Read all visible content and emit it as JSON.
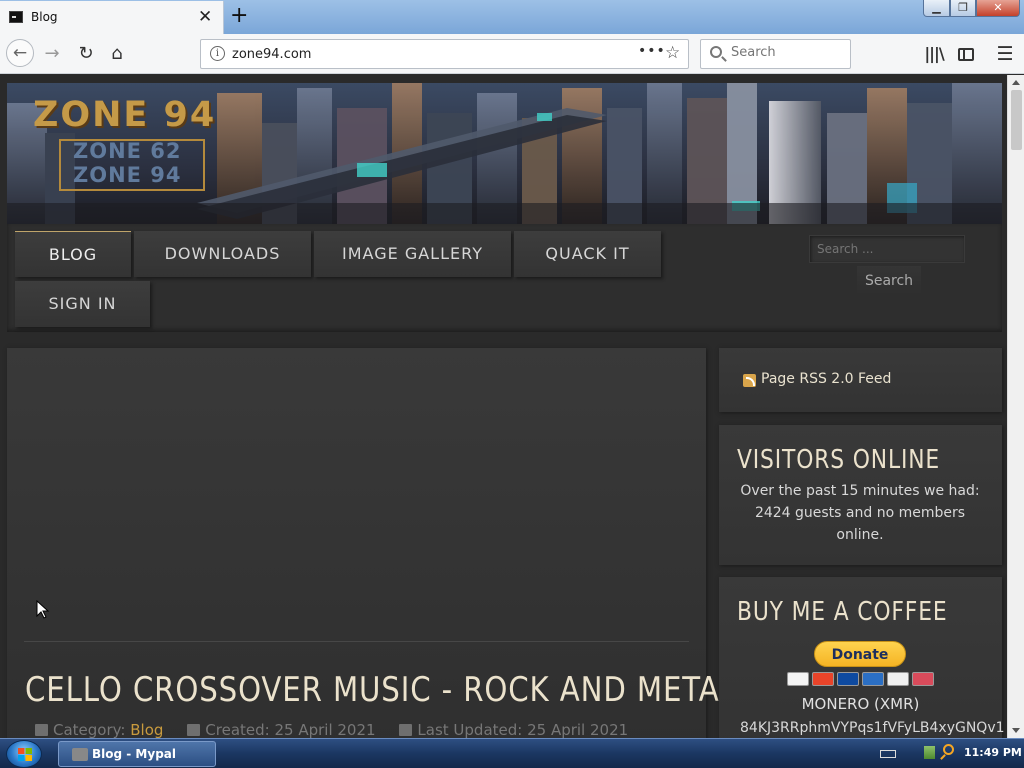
{
  "browser": {
    "tab_title": "Blog",
    "url": "zone94.com",
    "search_placeholder": "Search",
    "window_controls": {
      "minimize": "▁",
      "maximize": "❐",
      "close": "✕"
    },
    "icons": [
      "back-arrow-icon",
      "forward-arrow-icon",
      "reload-icon",
      "home-icon",
      "info-icon",
      "page-actions-icon",
      "bookmark-star-icon",
      "search-icon",
      "library-icon",
      "sidebar-icon",
      "hamburger-menu-icon"
    ]
  },
  "site": {
    "logo_main": "ZONE 94",
    "logo_line2": "ZONE 62",
    "logo_line3": "ZONE 94",
    "menu": {
      "blog": "BLOG",
      "downloads": "DOWNLOADS",
      "image_gallery": "IMAGE GALLERY",
      "quack_it": "QUACK IT",
      "sign_in": "SIGN IN"
    },
    "search": {
      "placeholder": "Search ...",
      "button": "Search"
    },
    "article": {
      "title": "CELLO CROSSOVER MUSIC - ROCK AND METAL",
      "category_label": "Category:",
      "category_value": "Blog",
      "created": "Created: 25 April 2021",
      "last_updated": "Last Updated: 25 April 2021"
    },
    "sidebar": {
      "rss_label": "Page RSS 2.0 Feed",
      "visitors_heading": "VISITORS ONLINE",
      "visitors_text": "Over the past 15 minutes we had: 2424 guests and no members online.",
      "coffee_heading": "BUY ME A COFFEE",
      "donate_button": "Donate",
      "xmr_label": "MONERO (XMR)",
      "xmr_address": "84KJ3RRphmVYPqs1fVFyLB4xyGNQv1"
    },
    "colors": {
      "accent_gold": "#c99b3e",
      "heading_cream": "#ebe2cc",
      "panel_dark": "#333333"
    }
  },
  "taskbar": {
    "task_label": "Blog - Mypal",
    "clock": "11:49 PM"
  }
}
